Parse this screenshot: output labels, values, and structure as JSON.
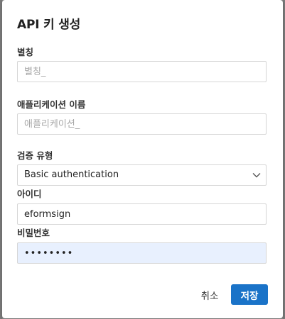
{
  "dialog": {
    "title": "API 키 생성",
    "alias": {
      "label": "별칭",
      "placeholder": "별칭_",
      "value": ""
    },
    "app_name": {
      "label": "애플리케이션 이름",
      "placeholder": "애플리케이션_",
      "value": ""
    },
    "auth_type": {
      "label": "검증 유형",
      "selected": "Basic authentication"
    },
    "user_id": {
      "label": "아이디",
      "value": "eformsign"
    },
    "password": {
      "label": "비밀번호",
      "value": "••••••••"
    },
    "buttons": {
      "cancel_label": "취소",
      "save_label": "저장"
    }
  },
  "colors": {
    "primary": "#1a73c8",
    "autofill_background": "#e8f0fe"
  },
  "icons": {
    "select_arrow": "chevron-down-icon"
  }
}
